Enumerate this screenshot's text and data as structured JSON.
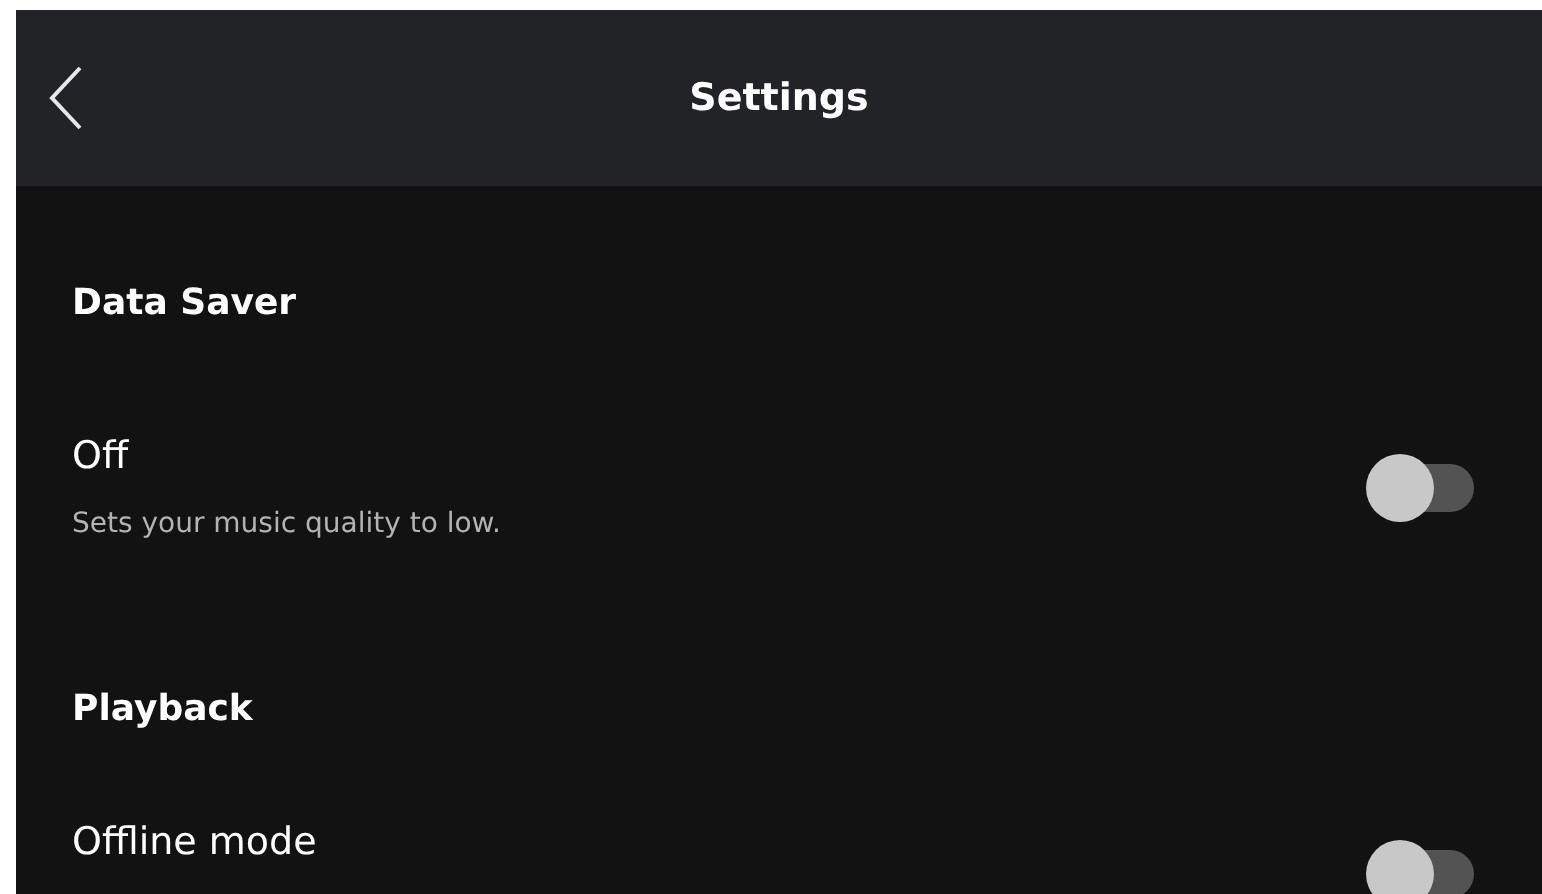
{
  "header": {
    "title": "Settings"
  },
  "sections": [
    {
      "title": "Data Saver",
      "settings": [
        {
          "label": "Off",
          "description": "Sets your music quality to low.",
          "on": false
        }
      ]
    },
    {
      "title": "Playback",
      "settings": [
        {
          "label": "Offline mode",
          "on": false
        }
      ]
    }
  ]
}
